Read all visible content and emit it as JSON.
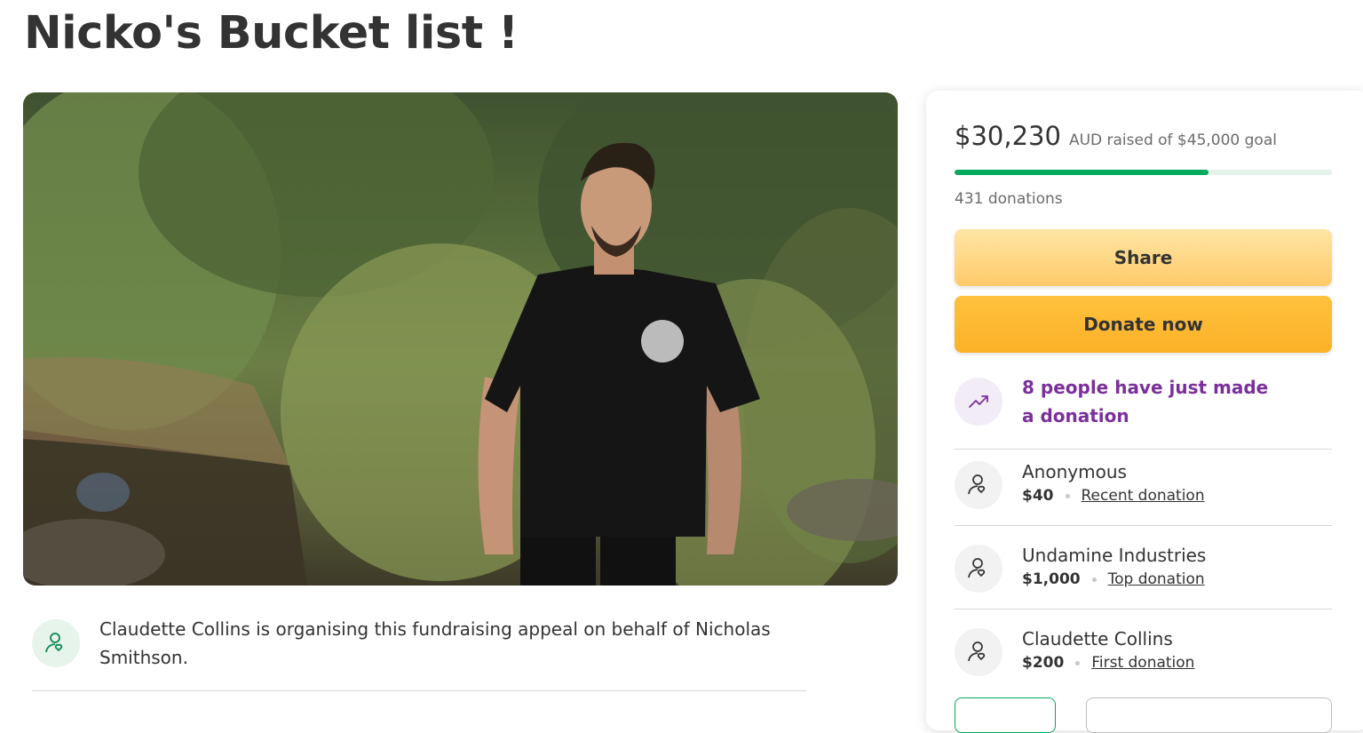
{
  "page": {
    "title": "Nicko's Bucket list !"
  },
  "organiser": {
    "text": "Claudette Collins is organising this fundraising appeal on behalf of Nicholas Smithson."
  },
  "fundraiser": {
    "raised": "$30,230",
    "raised_suffix": "AUD raised of $45,000 goal",
    "progress_fraction": 0.672,
    "donations_count": "431 donations",
    "share_label": "Share",
    "donate_label": "Donate now",
    "trending_text": "8 people have just made a donation"
  },
  "donors": [
    {
      "name": "Anonymous",
      "amount": "$40",
      "tag": "Recent donation"
    },
    {
      "name": "Undamine Industries",
      "amount": "$1,000",
      "tag": "Top donation"
    },
    {
      "name": "Claudette Collins",
      "amount": "$200",
      "tag": "First donation"
    }
  ],
  "colors": {
    "progress": "#02a95c",
    "progress_track": "#e4f2ea",
    "trending_text": "#7b2f9c",
    "share_button": "#ffd27a",
    "donate_button": "#fbb128"
  },
  "icons": {
    "organiser": "user-heart-icon",
    "trending": "trending-up-icon",
    "donor": "user-heart-icon"
  }
}
